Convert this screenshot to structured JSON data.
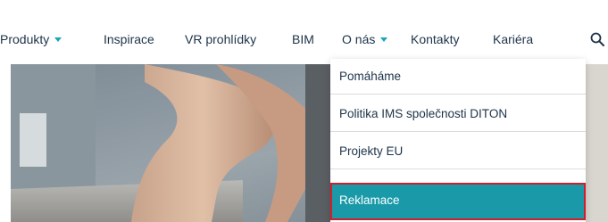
{
  "nav": {
    "items": [
      {
        "label": "Produkty",
        "has_dropdown": true
      },
      {
        "label": "Inspirace",
        "has_dropdown": false
      },
      {
        "label": "VR prohlídky",
        "has_dropdown": false
      },
      {
        "label": "BIM",
        "has_dropdown": false
      },
      {
        "label": "O nás",
        "has_dropdown": true
      },
      {
        "label": "Kontakty",
        "has_dropdown": false
      },
      {
        "label": "Kariéra",
        "has_dropdown": false
      }
    ],
    "search_icon": "search-icon",
    "caret_color": "#1aa7b8"
  },
  "dropdown": {
    "items": [
      {
        "label": "Pomáháme"
      },
      {
        "label": "Politika IMS společnosti DITON"
      },
      {
        "label": "Projekty EU"
      },
      {
        "label": "Reklamace"
      }
    ],
    "active_index": 3,
    "active_color": "#1a9aa8",
    "highlight_border_color": "#d01f2b"
  },
  "colors": {
    "text": "#1c3348"
  }
}
